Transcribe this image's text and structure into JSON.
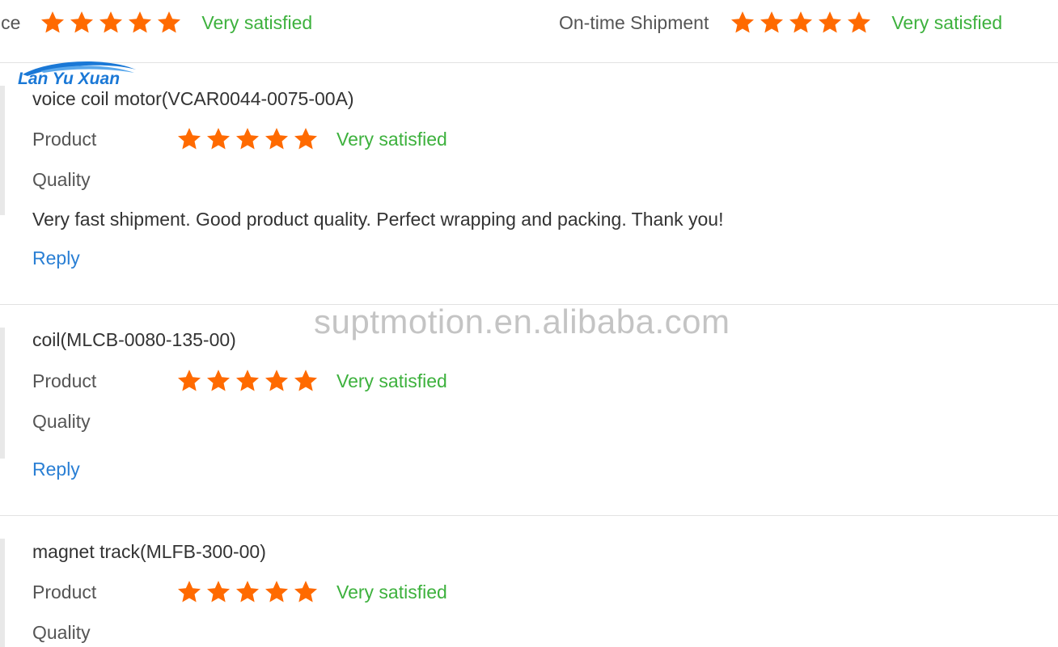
{
  "summary": {
    "service_label": "ice",
    "service_rating_text": "Very satisfied",
    "service_stars": 5,
    "shipment_label": "On-time Shipment",
    "shipment_rating_text": "Very satisfied",
    "shipment_stars": 5
  },
  "reviews": [
    {
      "product": "voice coil motor(VCAR0044-0075-00A)",
      "product_label": "Product",
      "quality_label": "Quality",
      "stars": 5,
      "rating_text": "Very satisfied",
      "comment": "Very fast shipment. Good product quality. Perfect wrapping and packing. Thank you!",
      "reply_label": "Reply"
    },
    {
      "product": "coil(MLCB-0080-135-00)",
      "product_label": "Product",
      "quality_label": "Quality",
      "stars": 5,
      "rating_text": "Very satisfied",
      "reply_label": "Reply"
    },
    {
      "product": "magnet track(MLFB-300-00)",
      "product_label": "Product",
      "quality_label": "Quality",
      "stars": 5,
      "rating_text": "Very satisfied"
    }
  ],
  "watermarks": {
    "logo_text": "Lan Yu Xuan",
    "site_text": "suptmotion.en.alibaba.com"
  },
  "colors": {
    "star": "#ff6a00",
    "satisfied": "#3db13d",
    "reply": "#2a7fd4"
  },
  "icons": {
    "star": "star-icon"
  }
}
